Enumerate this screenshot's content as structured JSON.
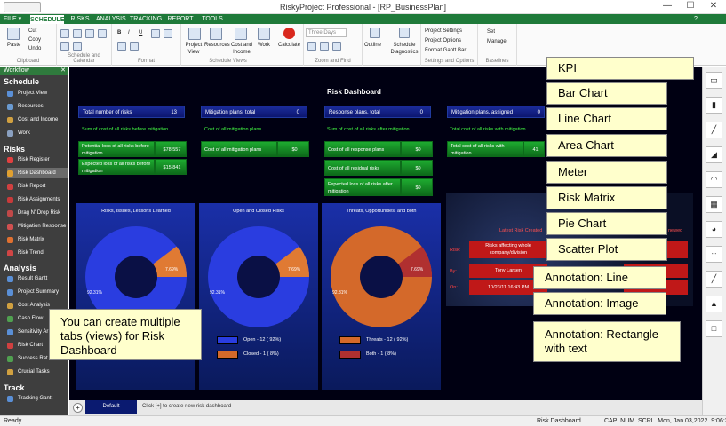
{
  "window": {
    "title": "RiskyProject Professional - [RP_BusinessPlan]",
    "minimize": "—",
    "maximize": "☐",
    "close": "✕"
  },
  "tabs": [
    {
      "label": "FILE ▾"
    },
    {
      "label": "SCHEDULE"
    },
    {
      "label": "RISKS"
    },
    {
      "label": "ANALYSIS"
    },
    {
      "label": "TRACKING"
    },
    {
      "label": "REPORT"
    },
    {
      "label": "TOOLS"
    }
  ],
  "help": "?",
  "ribbon": {
    "clipboard": {
      "label": "Clipboard",
      "paste": "Paste",
      "cut": "Cut",
      "copy": "Copy",
      "undo": "Undo"
    },
    "schedcal": {
      "label": "Schedule and Calendar"
    },
    "format": {
      "label": "Format"
    },
    "views": {
      "label": "Schedule Views",
      "items": [
        "Project View",
        "Resources",
        "Cost and Income",
        "Work"
      ]
    },
    "calculate": "Calculate",
    "zoom": {
      "label": "Zoom and Find",
      "value": "Three Days"
    },
    "outline": "Outline",
    "diag": "Schedule Diagnostics",
    "settings": {
      "label": "Settings and Options",
      "items": [
        "Project Settings",
        "Project Options",
        "Format Gantt Bar"
      ]
    },
    "baselines": {
      "label": "Baselines",
      "items": [
        "Set",
        "Manage"
      ]
    }
  },
  "workflow": {
    "title": "Workflow",
    "close": "✕",
    "sections": [
      {
        "title": "Schedule",
        "items": [
          "Project View",
          "Resources",
          "Cost and Income",
          "Work"
        ]
      },
      {
        "title": "Risks",
        "items": [
          "Risk Register",
          "Risk Dashboard",
          "Risk Report",
          "Risk Assignments",
          "Drag N' Drop Risk",
          "Mitigation Response",
          "Risk Matrix",
          "Risk Trend"
        ]
      },
      {
        "title": "Analysis",
        "items": [
          "Result Gantt",
          "Project Summary",
          "Cost Analysis",
          "Cash Flow",
          "Sensitivity Ar",
          "Risk Chart",
          "Success Rat",
          "Crucial Tasks"
        ]
      },
      {
        "title": "Track",
        "items": [
          "Tracking Gantt"
        ]
      }
    ]
  },
  "dashboard": {
    "title": "Risk Dashboard",
    "kpis": [
      {
        "label": "Total number of risks",
        "value": "13"
      },
      {
        "label": "Mitigation plans, total",
        "value": "0"
      },
      {
        "label": "Response plans, total",
        "value": "0"
      },
      {
        "label": "Mitigation plans, assigned",
        "value": "0"
      }
    ],
    "sums": [
      "Sum of cost of all risks before mitigation",
      "Cost of all mitigation plans",
      "Sum of cost of all risks after mitigation",
      "Total cost of all risks with mitigation"
    ],
    "col1": [
      {
        "label": "Potential loss of all risks before mitigation",
        "value": "$78,557"
      },
      {
        "label": "Expected loss of all risks before mitigation",
        "value": "$15,841"
      }
    ],
    "col2": [
      {
        "label": "Cost of all mitigation plans",
        "value": "$0"
      }
    ],
    "col3": [
      {
        "label": "Cost of all response plans",
        "value": "$0"
      },
      {
        "label": "Cost of all residual risks",
        "value": "$0"
      },
      {
        "label": "Expected loss of all risks after mitigation",
        "value": "$0"
      }
    ],
    "col4": [
      {
        "label": "Total cost of all risks with mitigation",
        "value": "41"
      }
    ],
    "pies": [
      {
        "title": "Risks, Issues, Lessons Learned",
        "big": "92.31%",
        "small": "7.69%"
      },
      {
        "title": "Open and Closed Risks",
        "big": "92.31%",
        "small": "7.69%",
        "legend": [
          "Open - 12 ( 92%)",
          "Closed - 1 ( 8%)"
        ]
      },
      {
        "title": "Threats, Opportunities, and both",
        "big": "92.31%",
        "small": "7.69%",
        "legend": [
          "Threats - 12 ( 92%)",
          "Both - 1 ( 8%)"
        ]
      }
    ],
    "latest": {
      "title": "Latest Risk Created",
      "risk": "Risk:",
      "by": "By:",
      "on": "On:",
      "riskval": "Risks affecting whole company/division",
      "byval": "Tony Larsen",
      "onval": "10/23/11 16:43 PM",
      "right": "newed"
    },
    "tab": "Default",
    "hint": "Click [+] to create new risk dashboard"
  },
  "callouts": {
    "tabs": "You can create multiple tabs (views) for Risk Dashboard",
    "kpi": "KPI",
    "bar": "Bar Chart",
    "line": "Line Chart",
    "area": "Area Chart",
    "meter": "Meter",
    "matrix": "Risk Matrix",
    "pie": "Pie Chart",
    "scatter": "Scatter Plot",
    "annline": "Annotation: Line",
    "annimg": "Annotation: Image",
    "annrect": "Annotation: Rectangle with text"
  },
  "status": {
    "left": "Ready",
    "center": "Risk Dashboard",
    "right": "CAP  NUM  SCRL  Mon, Jan 03,2022  9:06:31 PM"
  },
  "colors": {
    "pie_blue": "#2a3de0",
    "pie_orange": "#d4692a",
    "pie_orange_small": "#e07a33",
    "pie_red": "#b03030"
  }
}
